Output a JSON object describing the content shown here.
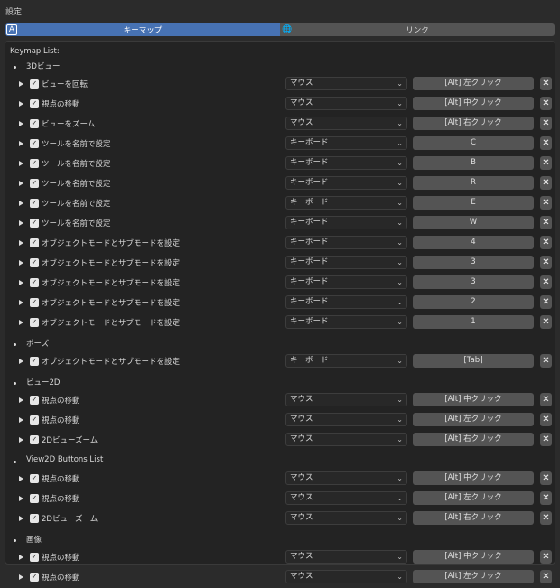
{
  "settings_label": "設定:",
  "tabs": [
    {
      "label": "キーマップ",
      "icon": "text-icon",
      "icon_glyph": "A"
    },
    {
      "label": "リンク",
      "icon": "globe-icon",
      "icon_glyph": "🌐"
    }
  ],
  "keymap_title": "Keymap List:",
  "groups": [
    {
      "title": "3Dビュー",
      "items": [
        {
          "name": "ビューを回転",
          "type": "マウス",
          "key": "[Alt] 左クリック"
        },
        {
          "name": "視点の移動",
          "type": "マウス",
          "key": "[Alt] 中クリック"
        },
        {
          "name": "ビューをズーム",
          "type": "マウス",
          "key": "[Alt] 右クリック"
        },
        {
          "name": "ツールを名前で設定",
          "type": "キーボード",
          "key": "C"
        },
        {
          "name": "ツールを名前で設定",
          "type": "キーボード",
          "key": "B"
        },
        {
          "name": "ツールを名前で設定",
          "type": "キーボード",
          "key": "R"
        },
        {
          "name": "ツールを名前で設定",
          "type": "キーボード",
          "key": "E"
        },
        {
          "name": "ツールを名前で設定",
          "type": "キーボード",
          "key": "W"
        },
        {
          "name": "オブジェクトモードとサブモードを設定",
          "type": "キーボード",
          "key": "4"
        },
        {
          "name": "オブジェクトモードとサブモードを設定",
          "type": "キーボード",
          "key": "3"
        },
        {
          "name": "オブジェクトモードとサブモードを設定",
          "type": "キーボード",
          "key": "3"
        },
        {
          "name": "オブジェクトモードとサブモードを設定",
          "type": "キーボード",
          "key": "2"
        },
        {
          "name": "オブジェクトモードとサブモードを設定",
          "type": "キーボード",
          "key": "1"
        }
      ]
    },
    {
      "title": "ポーズ",
      "items": [
        {
          "name": "オブジェクトモードとサブモードを設定",
          "type": "キーボード",
          "key": "[Tab]"
        }
      ]
    },
    {
      "title": "ビュー2D",
      "items": [
        {
          "name": "視点の移動",
          "type": "マウス",
          "key": "[Alt] 中クリック"
        },
        {
          "name": "視点の移動",
          "type": "マウス",
          "key": "[Alt] 左クリック"
        },
        {
          "name": "2Dビューズーム",
          "type": "マウス",
          "key": "[Alt] 右クリック"
        }
      ]
    },
    {
      "title": "View2D Buttons List",
      "items": [
        {
          "name": "視点の移動",
          "type": "マウス",
          "key": "[Alt] 中クリック"
        },
        {
          "name": "視点の移動",
          "type": "マウス",
          "key": "[Alt] 左クリック"
        },
        {
          "name": "2Dビューズーム",
          "type": "マウス",
          "key": "[Alt] 右クリック"
        }
      ]
    },
    {
      "title": "画像",
      "items": [
        {
          "name": "視点の移動",
          "type": "マウス",
          "key": "[Alt] 中クリック"
        },
        {
          "name": "視点の移動",
          "type": "マウス",
          "key": "[Alt] 左クリック"
        }
      ]
    }
  ]
}
